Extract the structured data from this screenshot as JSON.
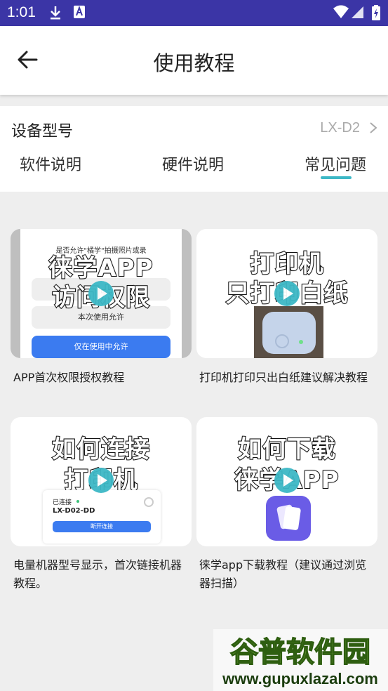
{
  "status_bar": {
    "time": "1:01"
  },
  "app_bar": {
    "title": "使用教程"
  },
  "device": {
    "label": "设备型号",
    "model": "LX-D2"
  },
  "tabs": [
    {
      "label": "软件说明",
      "selected": false
    },
    {
      "label": "硬件说明",
      "selected": false
    },
    {
      "label": "常见问题",
      "selected": true
    }
  ],
  "videos": [
    {
      "thumb_line1": "徕学APP",
      "thumb_line2": "访问权限",
      "screen_small_top": "是否允许\"橘学\"拍摄照片或录",
      "screen_btn1": "本次使用允许",
      "screen_btn2": "仅在使用中允许",
      "caption": "APP首次权限授权教程"
    },
    {
      "thumb_line1": "打印机",
      "thumb_line2": "只打印白纸",
      "caption": "打印机打印只出白纸建议解决教程"
    },
    {
      "thumb_line1": "如何连接",
      "thumb_line2": "打印机",
      "connected_label": "已连接",
      "connected_device": "LX-D02-DD",
      "disconnect_label": "断开连接",
      "caption": "电量机器型号显示，首次链接机器教程。"
    },
    {
      "thumb_line1": "如何下载",
      "thumb_line2": "徕学APP",
      "caption": "徕学app下载教程（建议通过浏览器扫描）"
    }
  ],
  "watermark": {
    "text": "谷普软件园",
    "url": "www.gupuxlazal.com"
  },
  "colors": {
    "status_bar": "#3b35a6",
    "accent": "#3db8c6",
    "blue_button": "#3b7bf0",
    "app_icon": "#6a5ce6"
  }
}
